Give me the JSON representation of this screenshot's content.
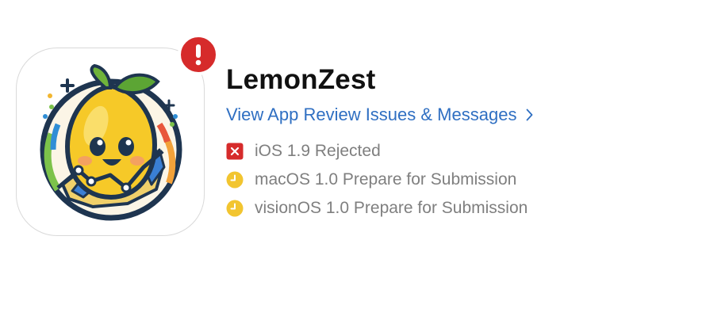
{
  "app": {
    "name": "LemonZest",
    "icon": "lemon-mascot-icon",
    "badge_icon": "exclamation-icon",
    "review_link": "View App Review Issues & Messages"
  },
  "platforms": [
    {
      "label": "iOS 1.9 Rejected",
      "status_icon": "rejected-x-icon",
      "status_color": "#d62b2b"
    },
    {
      "label": "macOS 1.0 Prepare for Submission",
      "status_icon": "clock-icon",
      "status_color": "#f2c530"
    },
    {
      "label": "visionOS 1.0 Prepare for Submission",
      "status_icon": "clock-icon",
      "status_color": "#f2c530"
    }
  ],
  "colors": {
    "link": "#2f6fc2",
    "alert": "#d62b2b",
    "pending": "#f2c530",
    "status_text": "#7f7f7f"
  }
}
